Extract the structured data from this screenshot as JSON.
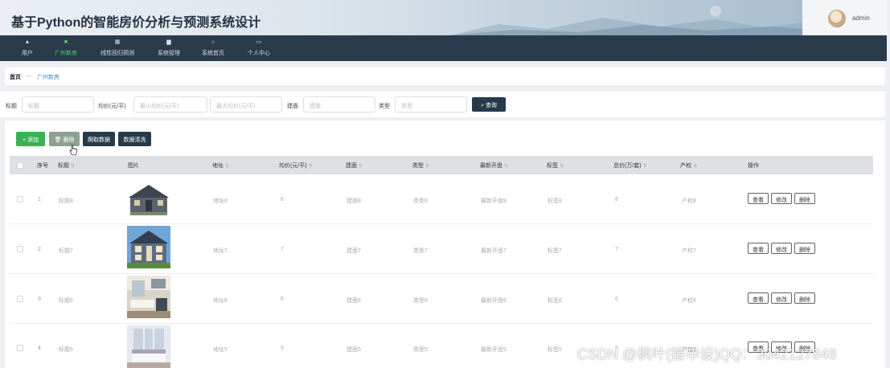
{
  "app_title": "基于Python的智能房价分析与预测系统设计",
  "user": {
    "name": "admin"
  },
  "nav": {
    "items": [
      {
        "label": "用户",
        "icon": "home-icon",
        "active": false
      },
      {
        "label": "广州新房",
        "icon": "list-icon",
        "active": true
      },
      {
        "label": "线性回归预测",
        "icon": "grid-icon",
        "active": false
      },
      {
        "label": "系统管理",
        "icon": "folder-icon",
        "active": false
      },
      {
        "label": "系统首页",
        "icon": "house-outline-icon",
        "active": false
      },
      {
        "label": "个人中心",
        "icon": "profile-card-icon",
        "active": false
      }
    ]
  },
  "breadcrumb": {
    "home": "首页",
    "separator": "—",
    "current": "广州新房"
  },
  "search": {
    "title_label": "标题",
    "title_placeholder": "标题",
    "price_label": "均价(元/平)",
    "min_price_placeholder": "最小均价(元/平)",
    "max_price_placeholder": "最大均价(元/平)",
    "building_label": "建面",
    "building_placeholder": "建面",
    "type_label": "类型",
    "type_placeholder": "类型",
    "query_button": "查询"
  },
  "toolbar": {
    "add": "添加",
    "delete": "删除",
    "crawl": "爬取数据",
    "clean": "数据清洗"
  },
  "table": {
    "headers": {
      "index": "序号",
      "title": "标题",
      "image": "图片",
      "address": "地址",
      "avg_price": "均价(元/平)",
      "area": "建面",
      "type": "类型",
      "latest_open": "最新开盘",
      "tags": "标签",
      "total_price": "总价(万/套)",
      "property_right": "产权",
      "actions": "操作"
    },
    "rows": [
      {
        "index": "1",
        "title": "标题8",
        "address": "地址8",
        "avg_price": "8",
        "area": "建面8",
        "type": "类型8",
        "latest_open": "最新开盘8",
        "tags": "标签8",
        "total_price": "8",
        "property_right": "产权8"
      },
      {
        "index": "2",
        "title": "标题7",
        "address": "地址7",
        "avg_price": "7",
        "area": "建面7",
        "type": "类型7",
        "latest_open": "最新开盘7",
        "tags": "标签7",
        "total_price": "7",
        "property_right": "产权7"
      },
      {
        "index": "3",
        "title": "标题6",
        "address": "地址6",
        "avg_price": "6",
        "area": "建面6",
        "type": "类型6",
        "latest_open": "最新开盘6",
        "tags": "标签6",
        "total_price": "6",
        "property_right": "产权6"
      },
      {
        "index": "4",
        "title": "标题5",
        "address": "地址5",
        "avg_price": "5",
        "area": "建面5",
        "type": "类型5",
        "latest_open": "最新开盘5",
        "tags": "标签5",
        "total_price": "5",
        "property_right": "产权5"
      }
    ],
    "actions": {
      "view": "查看",
      "edit": "修改",
      "delete": "删除"
    }
  },
  "watermark": "CSDN @枫叶(接毕设)QQ：3042127848",
  "colors": {
    "nav_bg": "#2a3b4c",
    "nav_active": "#4fd06f",
    "add_button": "#3bb055",
    "delete_button": "#8ea08f",
    "dark_button": "#273a4c",
    "header_bg": "#dde5ec"
  }
}
